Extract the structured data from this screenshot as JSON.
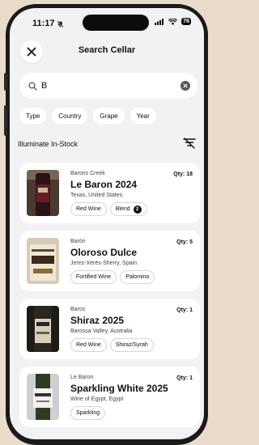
{
  "status_bar": {
    "time": "11:17",
    "battery": "76"
  },
  "header": {
    "title": "Search Cellar"
  },
  "search": {
    "value": "B"
  },
  "filters": [
    "Type",
    "Country",
    "Grape",
    "Year"
  ],
  "illuminate": {
    "label": "Illuminate In-Stock"
  },
  "wines": [
    {
      "producer": "Barons Creek",
      "name": "Le Baron 2024",
      "origin": "Texas, United States",
      "qty": "Qty: 18",
      "tags": [
        {
          "label": "Red Wine"
        },
        {
          "label": "Blend",
          "badge": "2"
        }
      ]
    },
    {
      "producer": "Barón",
      "name": "Oloroso Dulce",
      "origin": "Jerez-Xérès-Sherry, Spain",
      "qty": "Qty: 5",
      "tags": [
        {
          "label": "Fortified Wine"
        },
        {
          "label": "Palomino"
        }
      ]
    },
    {
      "producer": "Baros",
      "name": "Shiraz 2025",
      "origin": "Barossa Valley, Australia",
      "qty": "Qty: 1",
      "tags": [
        {
          "label": "Red Wine"
        },
        {
          "label": "Shiraz/Syrah"
        }
      ]
    },
    {
      "producer": "Le Baron",
      "name": "Sparkling White 2025",
      "origin": "Wine of Egypt, Egypt",
      "qty": "Qty: 1",
      "tags": [
        {
          "label": "Sparkling"
        }
      ]
    }
  ]
}
